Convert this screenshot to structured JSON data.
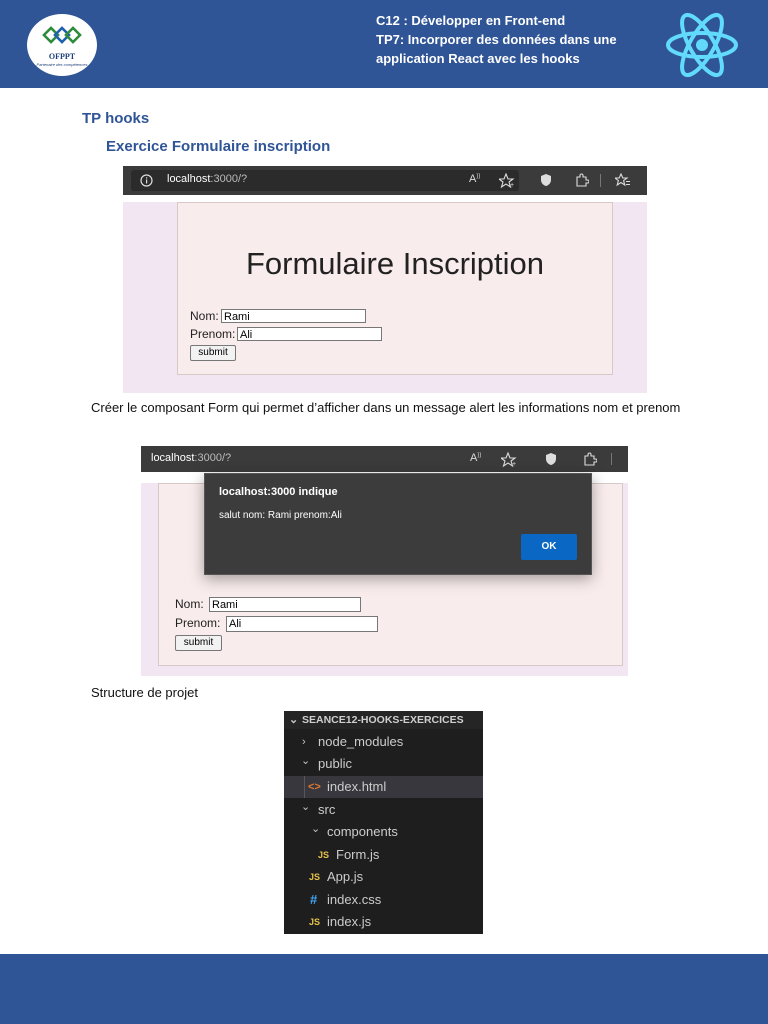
{
  "header": {
    "logo_text": "OFPPT",
    "logo_tagline": "Partenaire des compétences",
    "line1": "C12 : Développer en Front-end",
    "line2": "TP7: Incorporer des données dans une",
    "line3": "application React avec les hooks"
  },
  "headings": {
    "tp": "TP hooks",
    "exercise": "Exercice Formulaire inscription"
  },
  "browser1": {
    "url_host": "localhost",
    "url_path": ":3000/?",
    "icons": [
      "info-icon",
      "read-aloud-icon",
      "favorite-add-icon",
      "shield-icon",
      "extensions-icon",
      "favorites-icon"
    ]
  },
  "form1": {
    "title": "Formulaire Inscription",
    "nom_label": "Nom:",
    "nom_value": "Rami",
    "prenom_label": "Prenom:",
    "prenom_value": "Ali",
    "submit_label": "submit"
  },
  "paragraph1": "Créer le composant Form qui permet d’afficher dans un message alert les informations nom et prenom",
  "browser2": {
    "url_host": "localhost",
    "url_path": ":3000/?"
  },
  "alert": {
    "title": "localhost:3000 indique",
    "message": "salut nom: Rami prenom:Ali",
    "ok_label": "OK"
  },
  "form2": {
    "nom_label": "Nom:",
    "nom_value": "Rami",
    "prenom_label": "Prenom:",
    "prenom_value": "Ali",
    "submit_label": "submit"
  },
  "paragraph2": "Structure de projet",
  "explorer": {
    "root": "SEANCE12-HOOKS-EXERCICES",
    "items": [
      {
        "label": "node_modules",
        "icon": "chevron-right-icon",
        "glyph": "›"
      },
      {
        "label": "public",
        "icon": "chevron-down-icon",
        "glyph": "⌄"
      },
      {
        "label": "index.html",
        "icon": "html-file-icon",
        "glyph": "<>"
      },
      {
        "label": "src",
        "icon": "chevron-down-icon",
        "glyph": "⌄"
      },
      {
        "label": "components",
        "icon": "chevron-down-icon",
        "glyph": "⌄"
      },
      {
        "label": "Form.js",
        "icon": "js-file-icon",
        "glyph": "JS"
      },
      {
        "label": "App.js",
        "icon": "js-file-icon",
        "glyph": "JS"
      },
      {
        "label": "index.css",
        "icon": "css-file-icon",
        "glyph": "#"
      },
      {
        "label": "index.js",
        "icon": "js-file-icon",
        "glyph": "JS"
      }
    ]
  },
  "colors": {
    "brand_blue": "#2f5597",
    "react_cyan": "#61dafb",
    "ok_button": "#0a67c4"
  }
}
